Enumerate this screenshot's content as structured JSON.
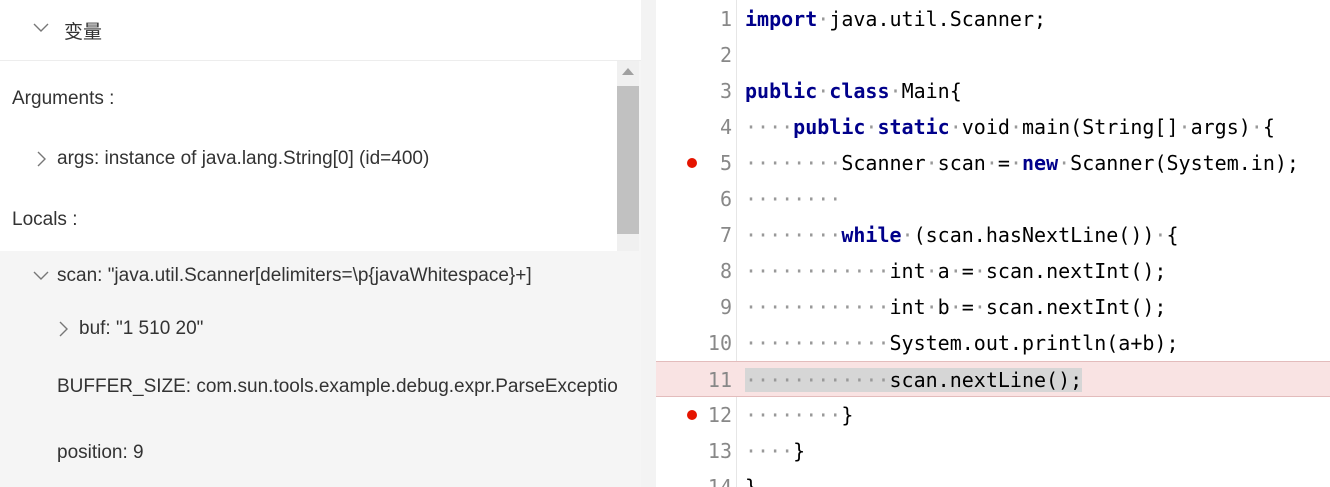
{
  "variables_panel": {
    "title": "变量",
    "sections": {
      "arguments": "Arguments :",
      "locals": "Locals :"
    },
    "args_item": "args: instance of java.lang.String[0] (id=400)",
    "scan_item": "scan: \"java.util.Scanner[delimiters=\\p{javaWhitespace}+]",
    "buf_item": "buf: \"1 510 20\"",
    "buffer_size_item": "BUFFER_SIZE: com.sun.tools.example.debug.expr.ParseException",
    "position_item": "position: 9"
  },
  "editor": {
    "lines": [
      {
        "n": "1",
        "breakpoint": false,
        "highlight": false,
        "tokens": [
          [
            "kw",
            "import"
          ],
          [
            "ws",
            "·"
          ],
          [
            "t",
            "java.util.Scanner;"
          ]
        ]
      },
      {
        "n": "2",
        "breakpoint": false,
        "highlight": false,
        "tokens": []
      },
      {
        "n": "3",
        "breakpoint": false,
        "highlight": false,
        "tokens": [
          [
            "kw",
            "public"
          ],
          [
            "ws",
            "·"
          ],
          [
            "kw",
            "class"
          ],
          [
            "ws",
            "·"
          ],
          [
            "t",
            "Main{"
          ]
        ]
      },
      {
        "n": "4",
        "breakpoint": false,
        "highlight": false,
        "tokens": [
          [
            "ws",
            "····"
          ],
          [
            "kw",
            "public"
          ],
          [
            "ws",
            "·"
          ],
          [
            "kw",
            "static"
          ],
          [
            "ws",
            "·"
          ],
          [
            "t",
            "void"
          ],
          [
            "ws",
            "·"
          ],
          [
            "t",
            "main(String[]"
          ],
          [
            "ws",
            "·"
          ],
          [
            "t",
            "args)"
          ],
          [
            "ws",
            "·"
          ],
          [
            "t",
            "{"
          ]
        ]
      },
      {
        "n": "5",
        "breakpoint": true,
        "highlight": false,
        "tokens": [
          [
            "ws",
            "········"
          ],
          [
            "t",
            "Scanner"
          ],
          [
            "ws",
            "·"
          ],
          [
            "t",
            "scan"
          ],
          [
            "ws",
            "·"
          ],
          [
            "t",
            "="
          ],
          [
            "ws",
            "·"
          ],
          [
            "kw",
            "new"
          ],
          [
            "ws",
            "·"
          ],
          [
            "t",
            "Scanner(System.in);"
          ]
        ]
      },
      {
        "n": "6",
        "breakpoint": false,
        "highlight": false,
        "tokens": [
          [
            "ws",
            "········"
          ]
        ]
      },
      {
        "n": "7",
        "breakpoint": false,
        "highlight": false,
        "tokens": [
          [
            "ws",
            "········"
          ],
          [
            "kw",
            "while"
          ],
          [
            "ws",
            "·"
          ],
          [
            "t",
            "(scan.hasNextLine())"
          ],
          [
            "ws",
            "·"
          ],
          [
            "t",
            "{"
          ]
        ]
      },
      {
        "n": "8",
        "breakpoint": false,
        "highlight": false,
        "tokens": [
          [
            "ws",
            "············"
          ],
          [
            "t",
            "int"
          ],
          [
            "ws",
            "·"
          ],
          [
            "t",
            "a"
          ],
          [
            "ws",
            "·"
          ],
          [
            "t",
            "="
          ],
          [
            "ws",
            "·"
          ],
          [
            "t",
            "scan.nextInt();"
          ]
        ]
      },
      {
        "n": "9",
        "breakpoint": false,
        "highlight": false,
        "tokens": [
          [
            "ws",
            "············"
          ],
          [
            "t",
            "int"
          ],
          [
            "ws",
            "·"
          ],
          [
            "t",
            "b"
          ],
          [
            "ws",
            "·"
          ],
          [
            "t",
            "="
          ],
          [
            "ws",
            "·"
          ],
          [
            "t",
            "scan.nextInt();"
          ]
        ]
      },
      {
        "n": "10",
        "breakpoint": false,
        "highlight": false,
        "tokens": [
          [
            "ws",
            "············"
          ],
          [
            "t",
            "System.out.println(a+b);"
          ]
        ]
      },
      {
        "n": "11",
        "breakpoint": false,
        "highlight": true,
        "tokens": [
          [
            "wssel",
            "············"
          ],
          [
            "sel",
            "scan.nextLine();"
          ]
        ]
      },
      {
        "n": "12",
        "breakpoint": true,
        "highlight": false,
        "tokens": [
          [
            "ws",
            "········"
          ],
          [
            "t",
            "}"
          ]
        ]
      },
      {
        "n": "13",
        "breakpoint": false,
        "highlight": false,
        "tokens": [
          [
            "ws",
            "····"
          ],
          [
            "t",
            "}"
          ]
        ]
      },
      {
        "n": "14",
        "breakpoint": false,
        "highlight": false,
        "tokens": [
          [
            "t",
            "}"
          ]
        ]
      }
    ]
  },
  "colors": {
    "keyword": "#00008b",
    "breakpoint": "#e51400",
    "current_line": "#f9e3e3"
  }
}
